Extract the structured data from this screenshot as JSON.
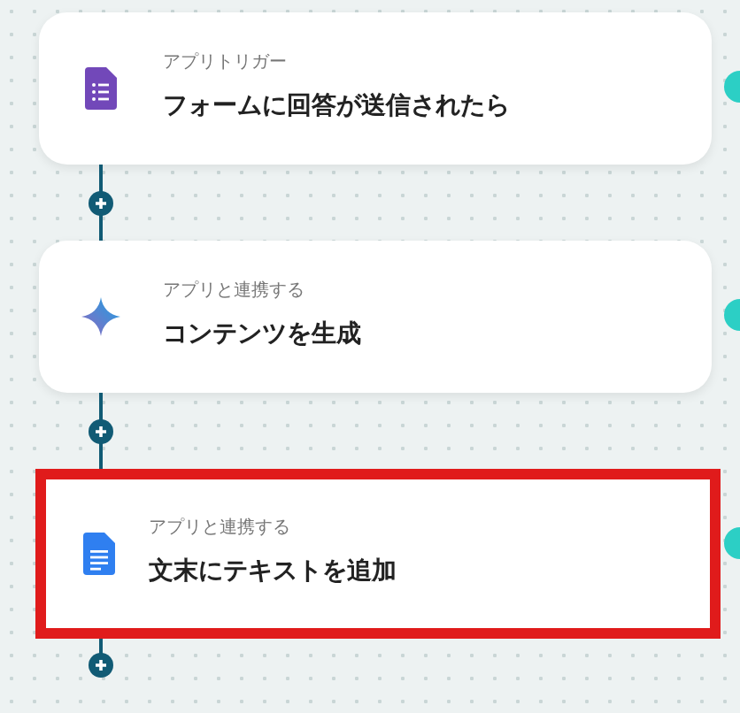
{
  "steps": [
    {
      "kind": "form",
      "label": "アプリトリガー",
      "title": "フォームに回答が送信されたら",
      "highlighted": false
    },
    {
      "kind": "ai",
      "label": "アプリと連携する",
      "title": "コンテンツを生成",
      "highlighted": false
    },
    {
      "kind": "doc",
      "label": "アプリと連携する",
      "title": "文末にテキストを追加",
      "highlighted": true
    }
  ]
}
